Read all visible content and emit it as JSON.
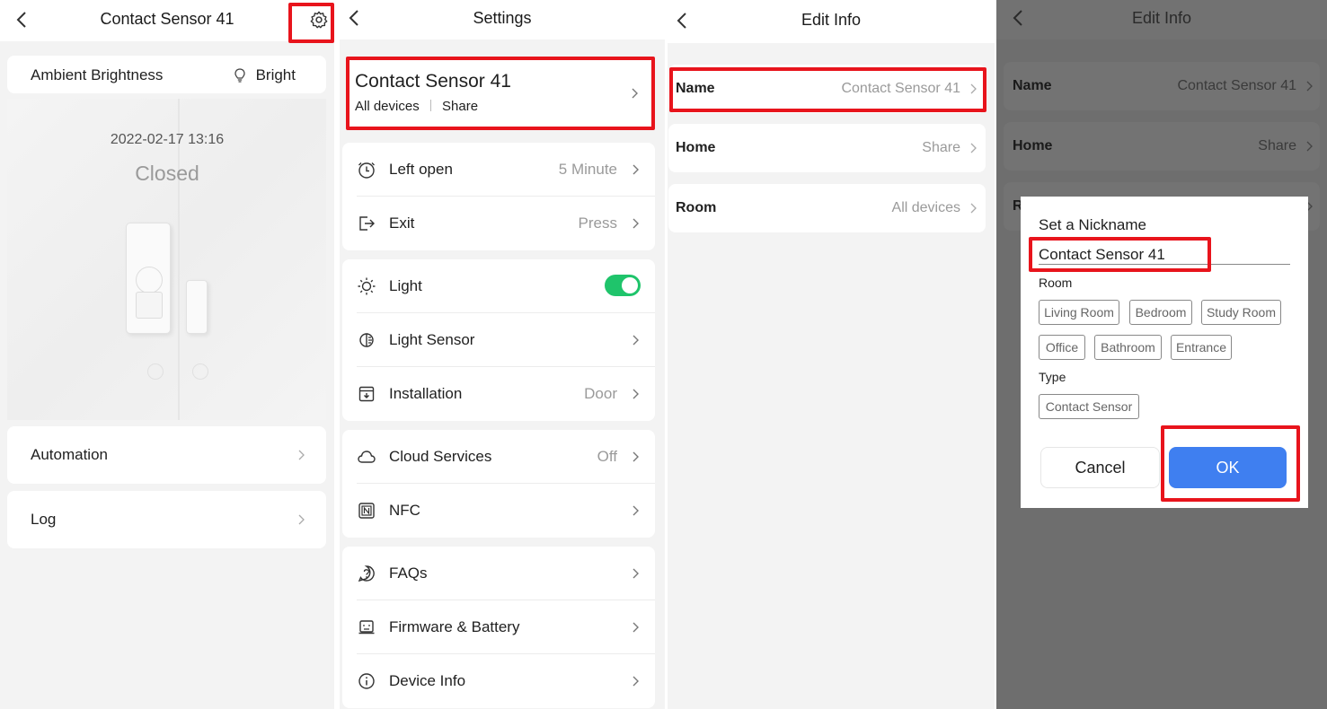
{
  "device_panel": {
    "title": "Contact Sensor 41",
    "ambient_label": "Ambient Brightness",
    "ambient_value": "Bright",
    "timestamp": "2022-02-17 13:16",
    "status": "Closed",
    "rows": [
      {
        "label": "Automation"
      },
      {
        "label": "Log"
      }
    ]
  },
  "settings_panel": {
    "title": "Settings",
    "device_name": "Contact Sensor 41",
    "device_room": "All devices",
    "device_home": "Share",
    "groups": [
      [
        {
          "label": "Left open",
          "value": "5 Minute",
          "icon": "clock-icon"
        },
        {
          "label": "Exit",
          "value": "Press",
          "icon": "exit-icon"
        }
      ],
      [
        {
          "label": "Light",
          "value": "",
          "icon": "sun-icon",
          "toggle": true
        },
        {
          "label": "Light Sensor",
          "value": "",
          "icon": "light-sensor-icon"
        },
        {
          "label": "Installation",
          "value": "Door",
          "icon": "install-icon"
        }
      ],
      [
        {
          "label": "Cloud Services",
          "value": "Off",
          "icon": "cloud-icon"
        },
        {
          "label": "NFC",
          "value": "",
          "icon": "nfc-icon"
        }
      ],
      [
        {
          "label": "FAQs",
          "value": "",
          "icon": "question-icon"
        },
        {
          "label": "Firmware & Battery",
          "value": "",
          "icon": "firmware-icon"
        },
        {
          "label": "Device Info",
          "value": "",
          "icon": "info-icon"
        }
      ]
    ]
  },
  "edit_panel": {
    "title": "Edit Info",
    "rows": [
      {
        "label": "Name",
        "value": "Contact Sensor 41"
      },
      {
        "label": "Home",
        "value": "Share"
      },
      {
        "label": "Room",
        "value": "All devices"
      }
    ]
  },
  "dialog_panel": {
    "title": "Edit Info",
    "bg_rows": [
      {
        "label": "Name",
        "value": "Contact Sensor 41"
      },
      {
        "label": "Home",
        "value": "Share"
      },
      {
        "label": "R",
        "value": ""
      }
    ],
    "dialog": {
      "title": "Set a Nickname",
      "nickname": "Contact Sensor 41",
      "room_label": "Room",
      "rooms": [
        "Living Room",
        "Bedroom",
        "Study Room",
        "Office",
        "Bathroom",
        "Entrance"
      ],
      "type_label": "Type",
      "types": [
        "Contact Sensor"
      ],
      "cancel": "Cancel",
      "ok": "OK"
    }
  },
  "colors": {
    "highlight": "#e8141c",
    "toggle_on": "#1fc46b",
    "ok_button": "#3f7ff0"
  }
}
